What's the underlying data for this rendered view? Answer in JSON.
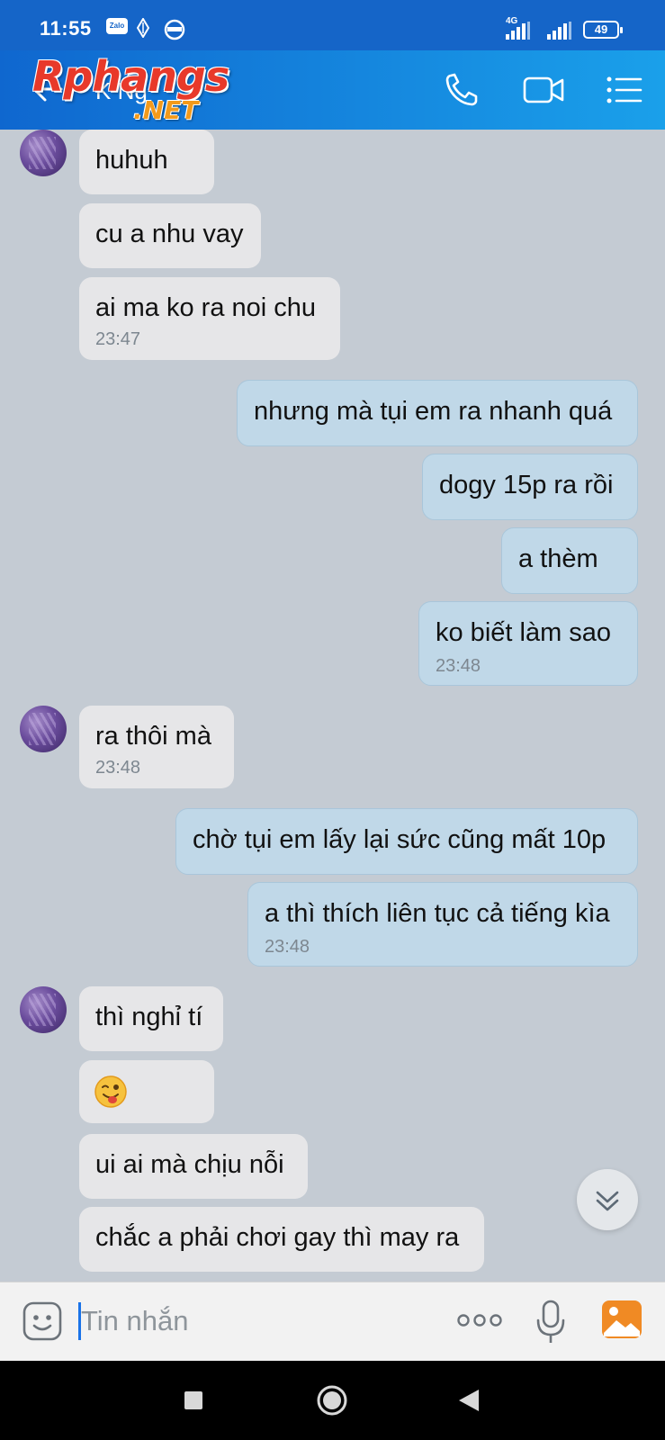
{
  "status_bar": {
    "time": "11:55",
    "zalo_badge": "Zalo",
    "network": "4G",
    "battery": "49"
  },
  "header": {
    "contact_name": "K Ng",
    "watermark_main": "Rphangs",
    "watermark_suffix": ".NET"
  },
  "messages": [
    {
      "side": "in",
      "text": "huhuh",
      "time": "",
      "avatar": true
    },
    {
      "side": "in",
      "text": "cu a nhu vay",
      "time": ""
    },
    {
      "side": "in",
      "text": "ai ma ko ra noi chu",
      "time": "23:47"
    },
    {
      "side": "out",
      "text": "nhưng mà tụi em ra nhanh quá",
      "time": ""
    },
    {
      "side": "out",
      "text": "dogy 15p ra rồi",
      "time": ""
    },
    {
      "side": "out",
      "text": "a thèm",
      "time": ""
    },
    {
      "side": "out",
      "text": "ko biết làm sao",
      "time": "23:48"
    },
    {
      "side": "in",
      "text": "ra thôi mà",
      "time": "23:48",
      "avatar": true
    },
    {
      "side": "out",
      "text": "chờ tụi em lấy lại sức cũng mất 10p",
      "time": ""
    },
    {
      "side": "out",
      "text": "a thì thích liên tục cả tiếng kìa",
      "time": "23:48"
    },
    {
      "side": "in",
      "text": "thì nghỉ tí",
      "time": "",
      "avatar": true
    },
    {
      "side": "in",
      "text": "",
      "time": "",
      "sticker": "winking-tongue-emoji"
    },
    {
      "side": "in",
      "text": "ui ai mà chịu nỗi",
      "time": ""
    },
    {
      "side": "in",
      "text": "chắc a phải chơi gay thì may ra",
      "time": ""
    }
  ],
  "input": {
    "placeholder": "Tin nhắn",
    "value": ""
  },
  "icons": {
    "call": "phone-icon",
    "video": "video-call-icon",
    "menu": "list-menu-icon",
    "emoji": "emoji-icon",
    "more": "more-dots-icon",
    "mic": "microphone-icon",
    "gallery": "image-gallery-icon"
  },
  "colors": {
    "header": "#1565c8",
    "incoming_bubble": "#e6e6e8",
    "outgoing_bubble": "#c0d8e8",
    "background": "#c4cbd3",
    "gallery_icon": "#f08a24"
  }
}
